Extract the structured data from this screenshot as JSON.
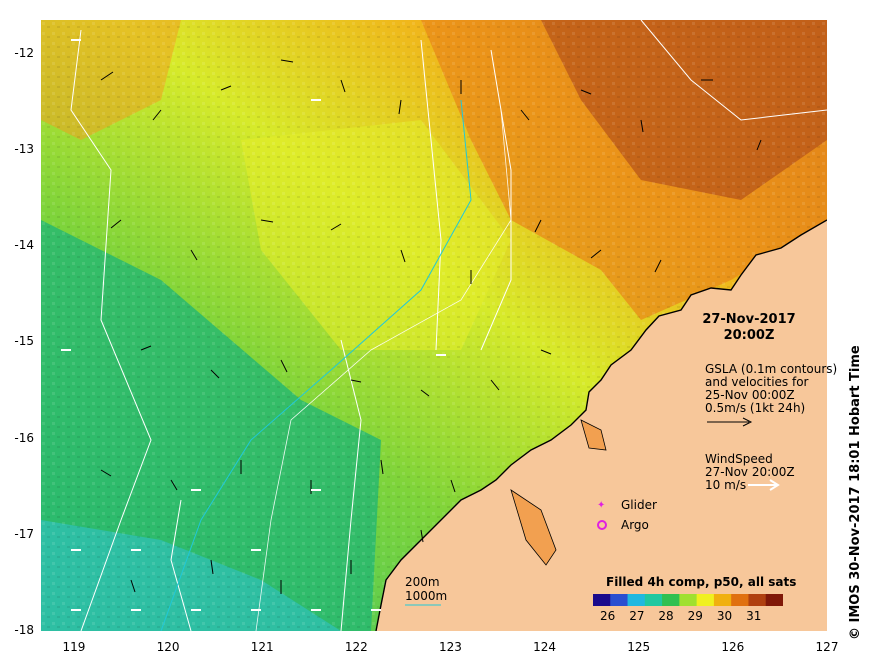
{
  "map": {
    "lat_range": [
      -18,
      -11.65
    ],
    "lon_range": [
      118.65,
      127
    ],
    "y_ticks": [
      "-12",
      "-13",
      "-14",
      "-15",
      "-16",
      "-17",
      "-18"
    ],
    "x_ticks": [
      "119",
      "120",
      "121",
      "122",
      "123",
      "124",
      "125",
      "126",
      "127"
    ]
  },
  "header": {
    "date": "27-Nov-2017",
    "time": "20:00Z"
  },
  "gsla": {
    "line1": "GSLA (0.1m contours)",
    "line2": "and velocities for",
    "line3": "25-Nov 00:00Z",
    "line4": "0.5m/s (1kt 24h)"
  },
  "wind": {
    "line1": "WindSpeed",
    "line2": "27-Nov 20:00Z",
    "line3": "10 m/s"
  },
  "markers": {
    "glider": "Glider",
    "argo": "Argo"
  },
  "bathy": {
    "label1": "200m",
    "label2": "1000m"
  },
  "colorbar": {
    "title": "Filled 4h comp, p50, all sats",
    "ticks": [
      "26",
      "27",
      "28",
      "29",
      "30",
      "31"
    ],
    "range": [
      25.5,
      32.0
    ],
    "colors": [
      "#1a0a8c",
      "#2a4fd0",
      "#20b8e0",
      "#20c8a0",
      "#30c050",
      "#a0e030",
      "#f0f020",
      "#f0b010",
      "#e07010",
      "#b04010",
      "#801808"
    ]
  },
  "credit": "© IMOS 30-Nov-2017 18:01 Hobart Time"
}
